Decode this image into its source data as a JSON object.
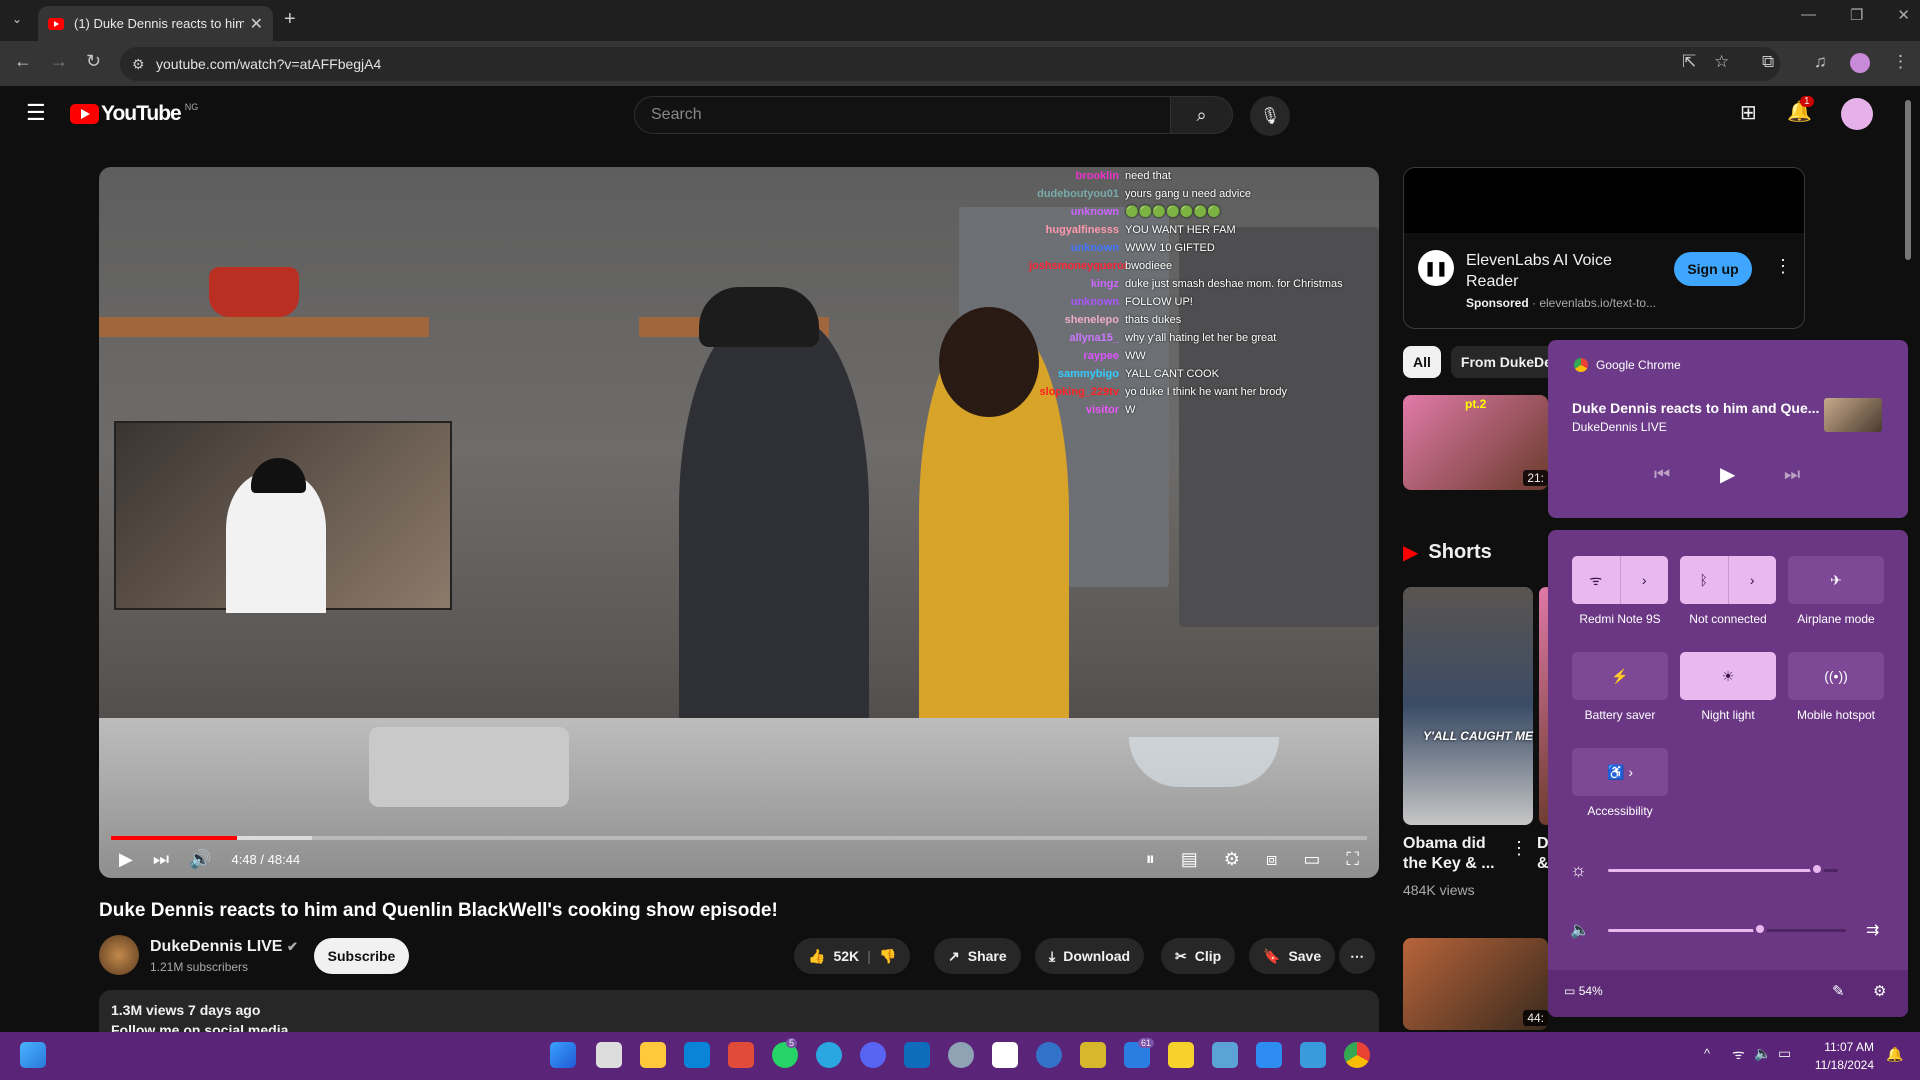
{
  "browser": {
    "tab_title": "(1) Duke Dennis reacts to him a",
    "url": "youtube.com/watch?v=atAFFbegjA4"
  },
  "youtube": {
    "logo_text": "YouTube",
    "country_code": "NG",
    "search_placeholder": "Search",
    "notification_count": "1"
  },
  "player": {
    "time": "4:48 / 48:44",
    "progress_fraction": 0.1,
    "chat": [
      {
        "user": "brooklin",
        "msg": "need that",
        "color": "#e3c"
      },
      {
        "user": "dudeboutyou01",
        "msg": "yours gang u need advice",
        "color": "#7aa"
      },
      {
        "user": "unknown",
        "msg": "🟢🟢🟢🟢🟢🟢🟢",
        "color": "#c6f"
      },
      {
        "user": "hugyalfinesss",
        "msg": "YOU WANT HER FAM",
        "color": "#f9a"
      },
      {
        "user": "unknown",
        "msg": "WWW 10 GIFTED",
        "color": "#47f"
      },
      {
        "user": "joshsmoneyqueror",
        "msg": "bwodieee",
        "color": "#f23"
      },
      {
        "user": "kingz",
        "msg": "duke just smash deshae mom. for Christmas",
        "color": "#c6f"
      },
      {
        "user": "unknown",
        "msg": "FOLLOW UP!",
        "color": "#a5f"
      },
      {
        "user": "shenelepo",
        "msg": "thats dukes",
        "color": "#eac"
      },
      {
        "user": "allyna15_",
        "msg": "why y'all hating let her be great",
        "color": "#c7f"
      },
      {
        "user": "raypee",
        "msg": "WW",
        "color": "#d5f"
      },
      {
        "user": "sammybigo",
        "msg": "YALL CANT COOK",
        "color": "#3cf"
      },
      {
        "user": "slopking_229tv",
        "msg": "yo duke I think he want her brody",
        "color": "#f22"
      },
      {
        "user": "visitor",
        "msg": "W",
        "color": "#e5f"
      }
    ]
  },
  "video": {
    "title": "Duke Dennis reacts to him and Quenlin BlackWell's cooking show episode!",
    "channel": "DukeDennis LIVE",
    "subscribers": "1.21M subscribers",
    "subscribe_label": "Subscribe",
    "likes": "52K",
    "share_label": "Share",
    "download_label": "Download",
    "clip_label": "Clip",
    "save_label": "Save",
    "description_stats": "1.3M views  7 days ago",
    "description_line": "Follow me on social media"
  },
  "sidebar": {
    "ad_title": "ElevenLabs AI Voice Reader",
    "ad_sponsored": "Sponsored",
    "ad_domain": "· elevenlabs.io/text-to...",
    "ad_cta": "Sign up",
    "chips": [
      "All",
      "From DukeDe"
    ],
    "thumb1_duration": "21:",
    "thumb1_tag": "pt.2",
    "shorts_label": "Shorts",
    "short1_title": "Obama did the Key & ...",
    "short1_views": "484K views",
    "short1_caption": "Y'ALL CAUGHT ME",
    "short2_title": "D &",
    "thumb2_duration": "44:"
  },
  "media_flyout": {
    "app": "Google Chrome",
    "title": "Duke Dennis reacts to him and Que...",
    "artist": "DukeDennis LIVE"
  },
  "quick_settings": {
    "wifi": "Redmi Note 9S",
    "bluetooth": "Not connected",
    "airplane": "Airplane mode",
    "battery_saver": "Battery saver",
    "night_light": "Night light",
    "hotspot": "Mobile hotspot",
    "accessibility": "Accessibility",
    "brightness": 0.92,
    "volume": 0.65,
    "battery": "54%"
  },
  "taskbar": {
    "whatsapp_badge": "5",
    "mail_badge": "61",
    "time": "11:07 AM",
    "date": "11/18/2024"
  }
}
